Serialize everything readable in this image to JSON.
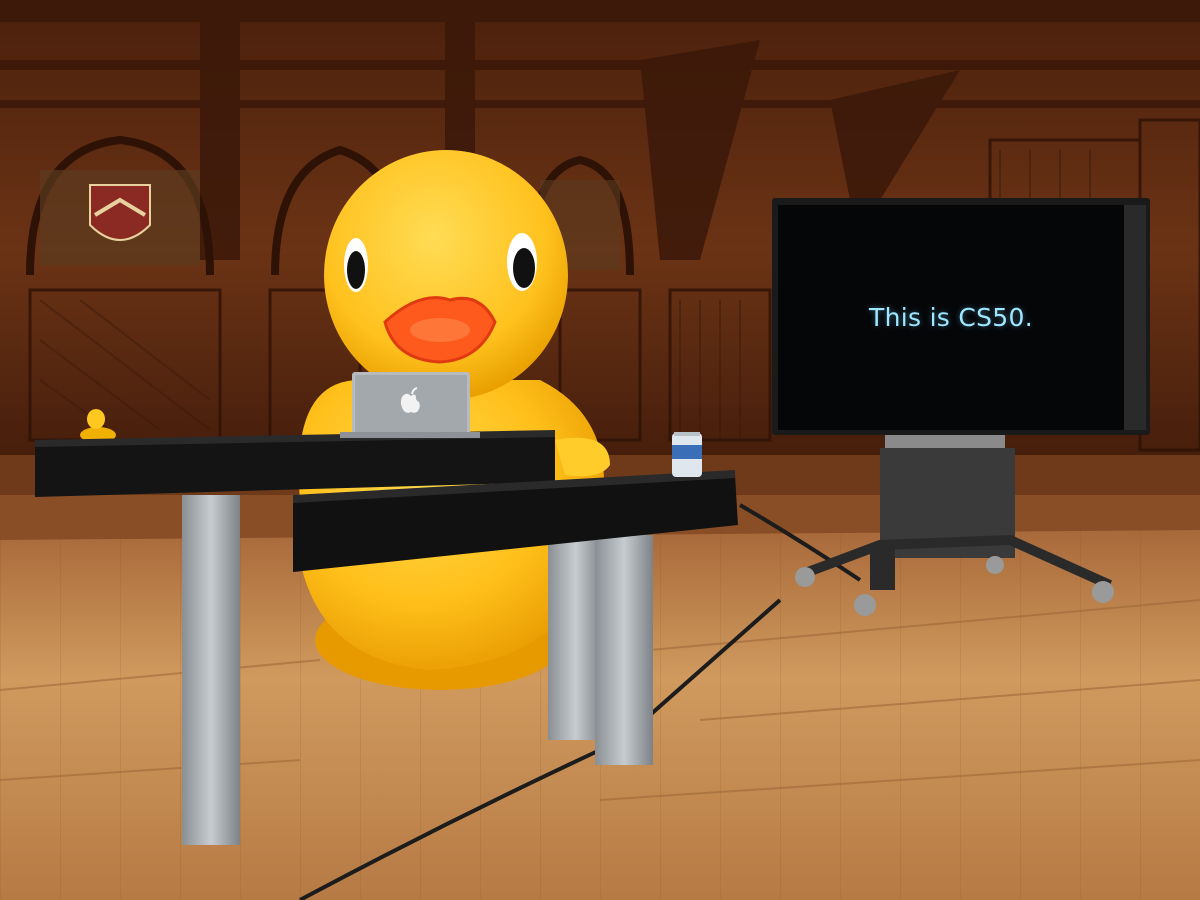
{
  "screen": {
    "text": "This is CS50."
  },
  "colors": {
    "wood_wall": "#5a2a12",
    "wood_floor": "#c88a52",
    "duck_yellow": "#ffc020",
    "duck_beak": "#ff5a1e",
    "desk_black": "#141414",
    "screen_text": "#9fe7ff"
  },
  "icons": {
    "laptop_logo": "apple-logo-icon"
  }
}
